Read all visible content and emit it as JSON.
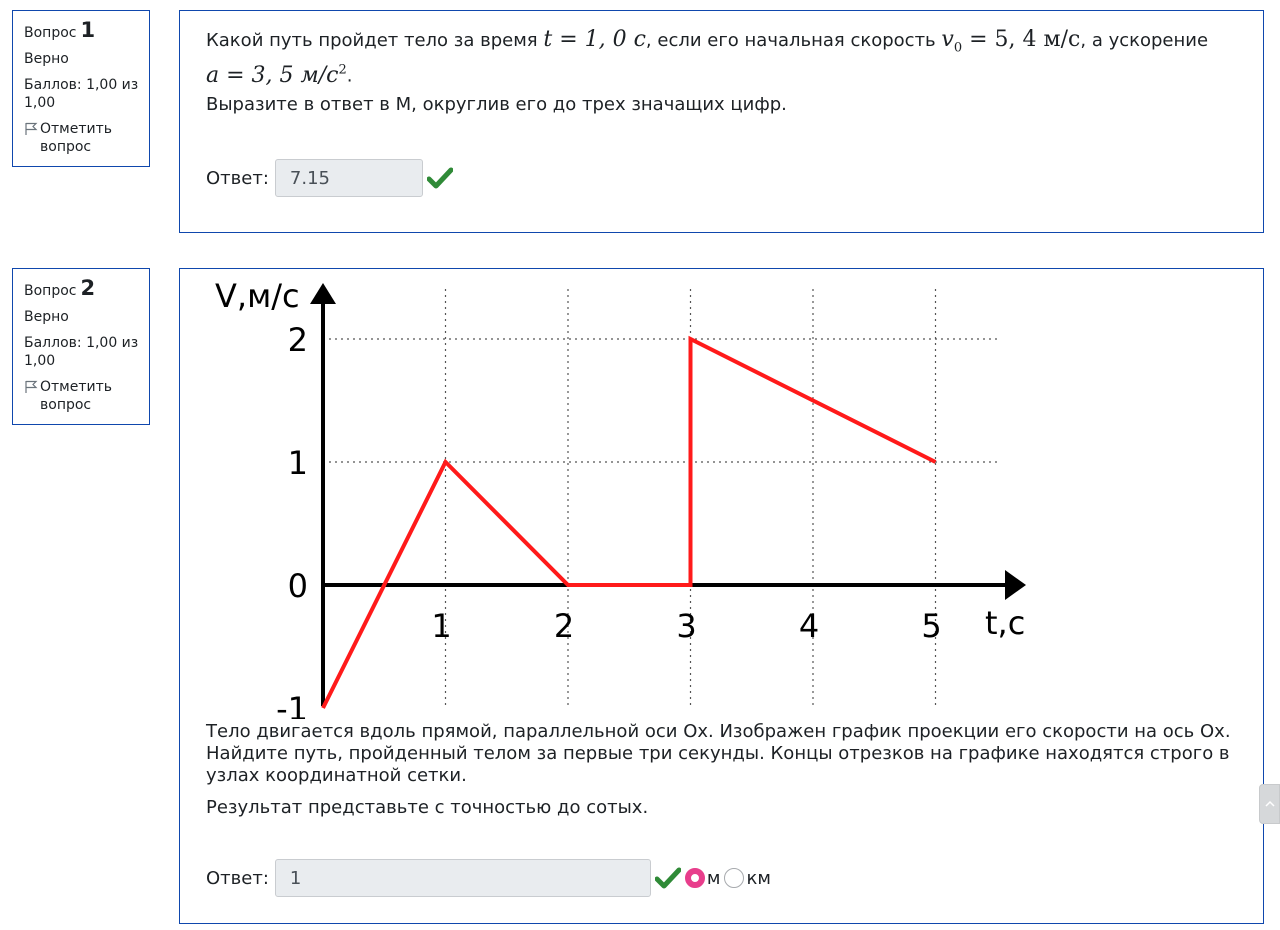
{
  "questions": [
    {
      "info": {
        "label": "Вопрос",
        "number": "1",
        "state": "Верно",
        "grade": "Баллов: 1,00 из 1,00",
        "flag": "Отметить вопрос"
      },
      "text": {
        "part1": "Какой путь пройдет тело за время",
        "t_math": "t = 1, 0 c",
        "part2": ", если его начальная скорость",
        "v_sym": "v",
        "v_sub": "0",
        "v_math": " = 5, 4 м/с",
        "part3": ", а ускорение",
        "a_math": "a = 3, 5 м/с",
        "a_sup": "2",
        "period": ".",
        "instruction": "Выразите в ответ в М, округлив  его до трех значащих цифр."
      },
      "answer": {
        "label": "Ответ:",
        "value": "7.15"
      }
    },
    {
      "info": {
        "label": "Вопрос",
        "number": "2",
        "state": "Верно",
        "grade": "Баллов: 1,00 из 1,00",
        "flag": "Отметить вопрос"
      },
      "text": {
        "statement": "Тело двигается вдоль прямой, параллельной оси Ox. Изображен график проекции его скорости на ось Ox. Найдите путь, пройденный телом за первые три секунды.  Концы отрезков на графике находятся строго в узлах координатной сетки.",
        "precision": "Результат представьте с точностью до сотых."
      },
      "answer": {
        "label": "Ответ:",
        "value": "1"
      },
      "units": [
        {
          "label": "м",
          "selected": true
        },
        {
          "label": "км",
          "selected": false
        }
      ]
    }
  ],
  "chart_data": {
    "type": "line",
    "ylabel": "V,м/с",
    "xlabel": "t,c",
    "x_ticks": [
      "1",
      "2",
      "3",
      "4",
      "5"
    ],
    "y_ticks": [
      "-1",
      "0",
      "1",
      "2"
    ],
    "xlim": [
      0,
      5
    ],
    "ylim": [
      -1,
      2
    ],
    "grid": true,
    "series": [
      {
        "color": "#ff1a1a",
        "x": [
          0,
          1,
          2,
          3,
          3,
          5
        ],
        "y": [
          -1,
          1,
          0,
          0,
          2,
          1
        ]
      }
    ]
  },
  "colors": {
    "border": "#0f47ad",
    "check": "#2f8a37",
    "accent": "#e83e8c",
    "line": "#ff1a1a"
  }
}
